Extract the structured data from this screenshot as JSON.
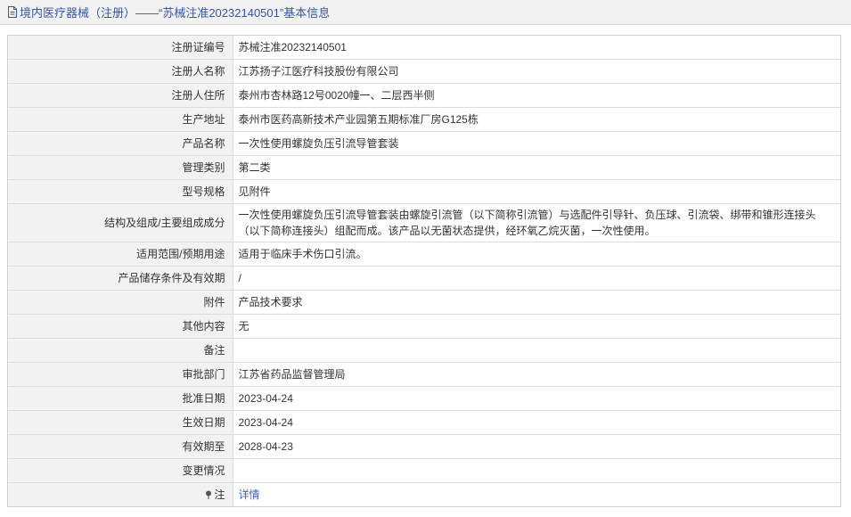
{
  "header": {
    "title": "境内医疗器械（注册）——“苏械注准20232140501”基本信息",
    "icon": "document-icon"
  },
  "rows": [
    {
      "label": "注册证编号",
      "value": "苏械注准20232140501"
    },
    {
      "label": "注册人名称",
      "value": "江苏扬子江医疗科技股份有限公司"
    },
    {
      "label": "注册人住所",
      "value": "泰州市杏林路12号0020幢一、二层西半侧"
    },
    {
      "label": "生产地址",
      "value": "泰州市医药高新技术产业园第五期标准厂房G125栋"
    },
    {
      "label": "产品名称",
      "value": "一次性使用螺旋负压引流导管套装"
    },
    {
      "label": "管理类别",
      "value": "第二类"
    },
    {
      "label": "型号规格",
      "value": "见附件"
    },
    {
      "label": "结构及组成/主要组成成分",
      "value": "一次性使用螺旋负压引流导管套装由螺旋引流管（以下简称引流管）与选配件引导针、负压球、引流袋、绑带和锥形连接头（以下简称连接头）组配而成。该产品以无菌状态提供，经环氧乙烷灭菌，一次性使用。"
    },
    {
      "label": "适用范围/预期用途",
      "value": "适用于临床手术伤口引流。"
    },
    {
      "label": "产品储存条件及有效期",
      "value": "/"
    },
    {
      "label": "附件",
      "value": "产品技术要求"
    },
    {
      "label": "其他内容",
      "value": "无"
    },
    {
      "label": "备注",
      "value": ""
    },
    {
      "label": "审批部门",
      "value": "江苏省药品监督管理局"
    },
    {
      "label": "批准日期",
      "value": "2023-04-24"
    },
    {
      "label": "生效日期",
      "value": "2023-04-24"
    },
    {
      "label": "有效期至",
      "value": "2028-04-23"
    },
    {
      "label": "变更情况",
      "value": ""
    }
  ],
  "note_row": {
    "label": "注",
    "icon": "pin-icon",
    "link": "详情"
  },
  "colors": {
    "header_bg": "#f2f2f2",
    "header_text": "#3355aa",
    "label_bg": "#f2f2f2",
    "link": "#3a5fcd",
    "border": "#dcdcdc"
  }
}
